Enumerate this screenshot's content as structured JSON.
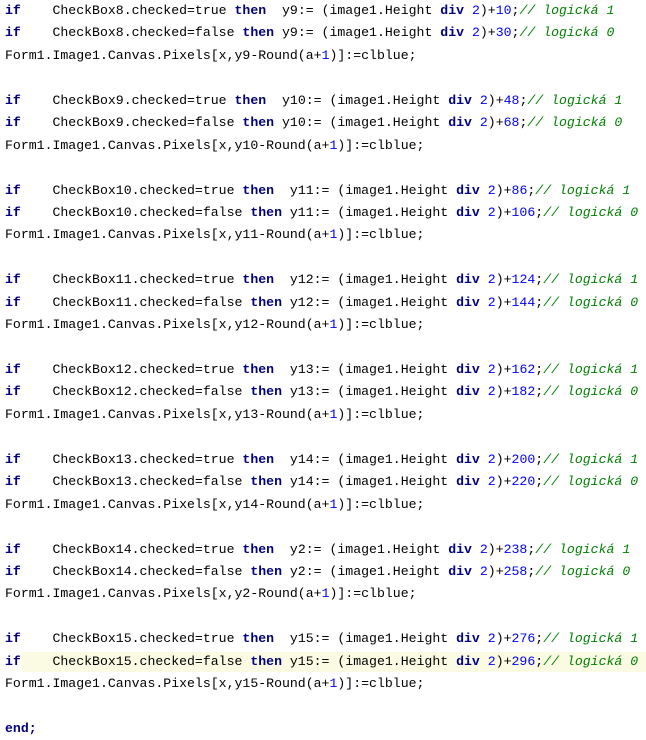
{
  "editor": {
    "language": "Pascal",
    "background_color": "#ffffff",
    "default_text_color": "#000000",
    "keyword_color": "#000080",
    "number_color": "#0000ff",
    "comment_color": "#008000",
    "highlight_color": "#fbfbe4",
    "font_size_px": 13.2,
    "line_height_px": 22.45
  },
  "code": {
    "blocks": [
      {
        "checkbox": "CheckBox8",
        "yvar": "y9",
        "true_offset": "10",
        "false_offset": "30",
        "comment_true": "// logická 1",
        "comment_false": "// logická 0",
        "pixels_line": "Form1.Image1.Canvas.Pixels[x,y9-Round(a+1)]:=clblue;"
      },
      {
        "checkbox": "CheckBox9",
        "yvar": "y10",
        "true_offset": "48",
        "false_offset": "68",
        "comment_true": "// logická 1",
        "comment_false": "// logická 0",
        "pixels_line": "Form1.Image1.Canvas.Pixels[x,y10-Round(a+1)]:=clblue;"
      },
      {
        "checkbox": "CheckBox10",
        "yvar": "y11",
        "true_offset": "86",
        "false_offset": "106",
        "comment_true": "// logická 1",
        "comment_false": "// logická 0",
        "pixels_line": "Form1.Image1.Canvas.Pixels[x,y11-Round(a+1)]:=clblue;"
      },
      {
        "checkbox": "CheckBox11",
        "yvar": "y12",
        "true_offset": "124",
        "false_offset": "144",
        "comment_true": "// logická 1",
        "comment_false": "// logická 0",
        "pixels_line": "Form1.Image1.Canvas.Pixels[x,y12-Round(a+1)]:=clblue;"
      },
      {
        "checkbox": "CheckBox12",
        "yvar": "y13",
        "true_offset": "162",
        "false_offset": "182",
        "comment_true": "// logická 1",
        "comment_false": "// logická 0",
        "pixels_line": "Form1.Image1.Canvas.Pixels[x,y13-Round(a+1)]:=clblue;"
      },
      {
        "checkbox": "CheckBox13",
        "yvar": "y14",
        "true_offset": "200",
        "false_offset": "220",
        "comment_true": "// logická 1",
        "comment_false": "// logická 0",
        "pixels_line": "Form1.Image1.Canvas.Pixels[x,y14-Round(a+1)]:=clblue;"
      },
      {
        "checkbox": "CheckBox14",
        "yvar": "y2",
        "true_offset": "238",
        "false_offset": "258",
        "comment_true": "// logická 1",
        "comment_false": "// logická 0",
        "pixels_line": "Form1.Image1.Canvas.Pixels[x,y2-Round(a+1)]:=clblue;"
      },
      {
        "checkbox": "CheckBox15",
        "yvar": "y15",
        "true_offset": "276",
        "false_offset": "296",
        "comment_true": "// logická 1",
        "comment_false": "// logická 0",
        "pixels_line": "Form1.Image1.Canvas.Pixels[x,y15-Round(a+1)]:=clblue;",
        "highlighted_line": "false"
      }
    ],
    "tokens": {
      "if": "if",
      "then": "then",
      "div": "div",
      "end": "end;",
      "checked_true": ".checked=true",
      "checked_false": ".checked=false",
      "assign": ":=",
      "expr_open": "(image1.Height ",
      "expr_mid": " 2)+",
      "semicolon": ";",
      "indent_if": "    ",
      "gap_true": "  ",
      "gap_false": " "
    },
    "end_statement": "end;"
  }
}
